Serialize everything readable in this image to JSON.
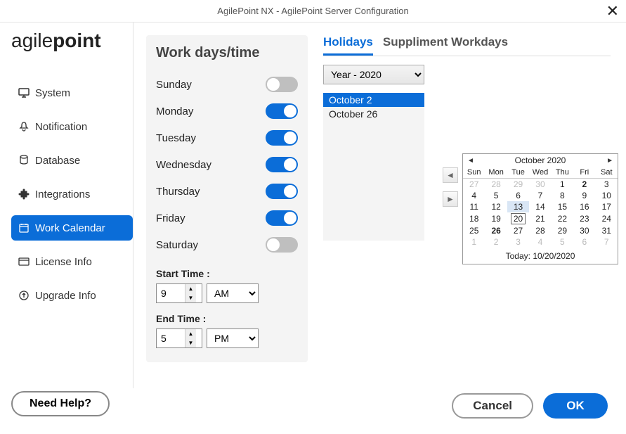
{
  "window": {
    "title": "AgilePoint NX - AgilePoint Server Configuration"
  },
  "logo": {
    "part1": "agile",
    "part2": "point"
  },
  "sidebar": {
    "items": [
      {
        "label": "System"
      },
      {
        "label": "Notification"
      },
      {
        "label": "Database"
      },
      {
        "label": "Integrations"
      },
      {
        "label": "Work Calendar"
      },
      {
        "label": "License Info"
      },
      {
        "label": "Upgrade Info"
      }
    ],
    "help": "Need Help?"
  },
  "workdays": {
    "title": "Work days/time",
    "days": [
      {
        "name": "Sunday",
        "on": false
      },
      {
        "name": "Monday",
        "on": true
      },
      {
        "name": "Tuesday",
        "on": true
      },
      {
        "name": "Wednesday",
        "on": true
      },
      {
        "name": "Thursday",
        "on": true
      },
      {
        "name": "Friday",
        "on": true
      },
      {
        "name": "Saturday",
        "on": false
      }
    ],
    "start_label": "Start Time :",
    "end_label": "End Time :",
    "start_hour": "9",
    "start_ampm": "AM",
    "end_hour": "5",
    "end_ampm": "PM"
  },
  "tabs": {
    "holidays": "Holidays",
    "suppliment": "Suppliment Workdays"
  },
  "year_select": "Year - 2020",
  "holiday_list": [
    {
      "label": "October 2",
      "selected": true
    },
    {
      "label": "October 26",
      "selected": false
    }
  ],
  "calendar": {
    "month_title": "October 2020",
    "wk_hdr": [
      "Sun",
      "Mon",
      "Tue",
      "Wed",
      "Thu",
      "Fri",
      "Sat"
    ],
    "rows": [
      [
        {
          "d": "27",
          "m": true
        },
        {
          "d": "28",
          "m": true
        },
        {
          "d": "29",
          "m": true
        },
        {
          "d": "30",
          "m": true
        },
        {
          "d": "1"
        },
        {
          "d": "2",
          "b": true
        },
        {
          "d": "3"
        }
      ],
      [
        {
          "d": "4"
        },
        {
          "d": "5"
        },
        {
          "d": "6"
        },
        {
          "d": "7"
        },
        {
          "d": "8"
        },
        {
          "d": "9"
        },
        {
          "d": "10"
        }
      ],
      [
        {
          "d": "11"
        },
        {
          "d": "12"
        },
        {
          "d": "13",
          "hl": true
        },
        {
          "d": "14"
        },
        {
          "d": "15"
        },
        {
          "d": "16"
        },
        {
          "d": "17"
        }
      ],
      [
        {
          "d": "18"
        },
        {
          "d": "19"
        },
        {
          "d": "20",
          "t": true
        },
        {
          "d": "21"
        },
        {
          "d": "22"
        },
        {
          "d": "23"
        },
        {
          "d": "24"
        }
      ],
      [
        {
          "d": "25"
        },
        {
          "d": "26",
          "b": true
        },
        {
          "d": "27"
        },
        {
          "d": "28"
        },
        {
          "d": "29"
        },
        {
          "d": "30"
        },
        {
          "d": "31"
        }
      ],
      [
        {
          "d": "1",
          "m": true
        },
        {
          "d": "2",
          "m": true
        },
        {
          "d": "3",
          "m": true
        },
        {
          "d": "4",
          "m": true
        },
        {
          "d": "5",
          "m": true
        },
        {
          "d": "6",
          "m": true
        },
        {
          "d": "7",
          "m": true
        }
      ]
    ],
    "today": "Today: 10/20/2020"
  },
  "buttons": {
    "cancel": "Cancel",
    "ok": "OK"
  }
}
